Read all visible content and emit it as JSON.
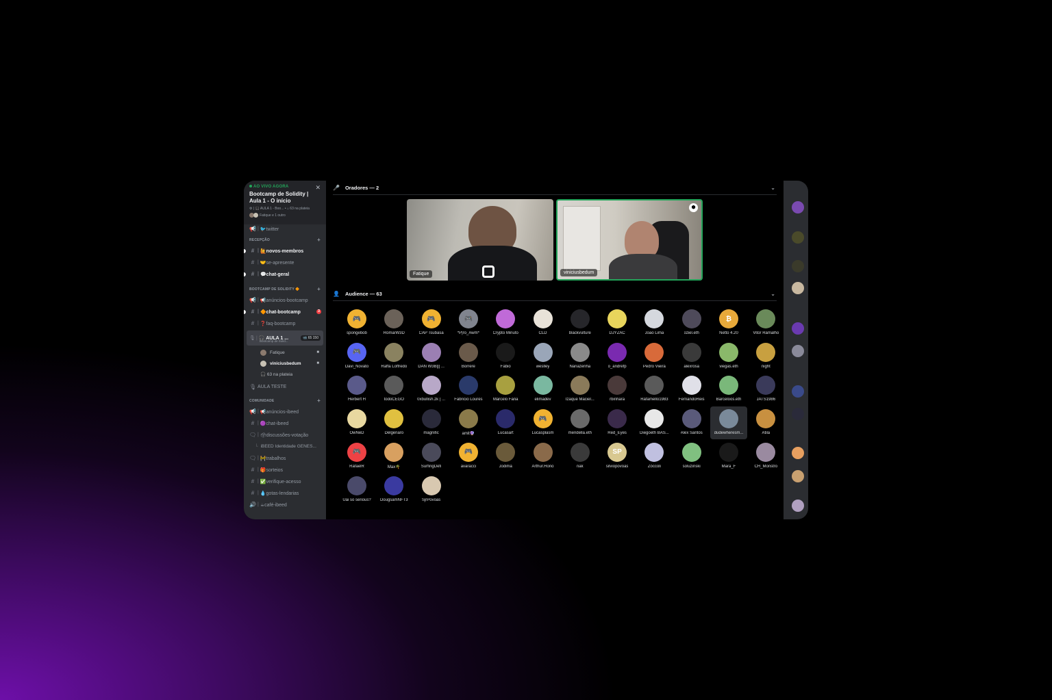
{
  "live": {
    "tag": "AO VIVO AGORA",
    "title": "Bootcamp de Solidity | Aula 1 - O início",
    "sub": "⚙ | 🎧 AULA 1 - Boo...  • ⌂ 63 na plateia",
    "users": "Fatique e 1 outro"
  },
  "sidebar": {
    "top_channel": "🐦twitter",
    "cat_recepcao": "RECEPÇÃO",
    "recepcao": [
      {
        "label": "🙋novos-membros",
        "unread": true
      },
      {
        "label": "🤝se-apresente",
        "unread": false
      },
      {
        "label": "💬chat-geral",
        "unread": true
      }
    ],
    "cat_bootcamp": "BOOTCAMP DE SOLIDITY 🔶",
    "bootcamp": [
      {
        "label": "📢anúncios-bootcamp",
        "unread": false
      },
      {
        "label": "🔶chat-bootcamp",
        "unread": true,
        "badge": "3"
      },
      {
        "label": "❓faq-bootcamp",
        "unread": false
      }
    ],
    "stage": {
      "name": "🎧 AULA 1 ...",
      "sub": "Bootcamp de Solid...",
      "count": "📹 65  150"
    },
    "voice_users": [
      {
        "name": "Fatique",
        "bold": false,
        "color": "#8b7a6e"
      },
      {
        "name": "viniciusbedum",
        "bold": true,
        "color": "#c7c1b4"
      }
    ],
    "audience_note": "🎧 63 na plateia",
    "aula_teste": "AULA TESTE",
    "cat_comunidade": "COMUNIDADE",
    "comunidade": [
      {
        "label": "📢anúncios-ibeed",
        "hash": "📢"
      },
      {
        "label": "🟣chat-ibeed",
        "hash": "#"
      },
      {
        "label": "🗳discussões-votação",
        "hash": "🗨"
      }
    ],
    "thread": "iBEED Identidade GENES...",
    "comunidade2": [
      {
        "label": "🚧trabalhos",
        "hash": "🗨"
      },
      {
        "label": "🎁sorteios",
        "hash": "#"
      },
      {
        "label": "✅verifique-acesso",
        "hash": "#"
      },
      {
        "label": "💧gotas-lendarias",
        "hash": "#"
      },
      {
        "label": "☕café-ibeed",
        "hash": "🔊"
      }
    ]
  },
  "speakers": {
    "header": "Oradores — 2",
    "tiles": [
      {
        "name": "Fatique"
      },
      {
        "name": "viniciusbedum"
      }
    ]
  },
  "audience": {
    "header": "Audience — 63",
    "members": [
      {
        "name": "spongebob",
        "color": "#f0b232",
        "glyph": "🎮"
      },
      {
        "name": "Roma/W3D",
        "color": "#6b6259",
        "glyph": ""
      },
      {
        "name": "CAP Tsubasa",
        "color": "#f0b232",
        "glyph": "🎮"
      },
      {
        "name": "*P|ro_Awm*",
        "color": "#80848e",
        "glyph": "🎮"
      },
      {
        "name": "Crypto Minuto",
        "color": "#c06ad8",
        "glyph": ""
      },
      {
        "name": "CLD",
        "color": "#e8e2d8",
        "glyph": ""
      },
      {
        "name": "blackvulture",
        "color": "#26262a",
        "glyph": ""
      },
      {
        "name": "DJYZAC",
        "color": "#e8d55c",
        "glyph": ""
      },
      {
        "name": "João Lima",
        "color": "#d5d8de",
        "glyph": ""
      },
      {
        "name": "oziel.eth",
        "color": "#4e4a5a",
        "glyph": ""
      },
      {
        "name": "Netto 4.20",
        "color": "#e8a93a",
        "glyph": "₿"
      },
      {
        "name": "Vitor Ramalho",
        "color": "#6a8a5a",
        "glyph": ""
      },
      {
        "name": "Davi_Novato",
        "color": "#5865f2",
        "glyph": "🎮"
      },
      {
        "name": "Raffa Loffredo",
        "color": "#8a8260",
        "glyph": ""
      },
      {
        "name": "DAN W3B||| ...",
        "color": "#9b7fb3",
        "glyph": ""
      },
      {
        "name": "Borrere",
        "color": "#6a5a4a",
        "glyph": ""
      },
      {
        "name": "Fábio",
        "color": "#1a1a1a",
        "glyph": ""
      },
      {
        "name": "weslley",
        "color": "#9aa6b8",
        "glyph": ""
      },
      {
        "name": "Nanazenha",
        "color": "#8a8a8a",
        "glyph": ""
      },
      {
        "name": "o_andrefp",
        "color": "#7a2ab0",
        "glyph": ""
      },
      {
        "name": "Pedro Vieira",
        "color": "#d86a3a",
        "glyph": ""
      },
      {
        "name": "alexrosa",
        "color": "#3a3a3a",
        "glyph": ""
      },
      {
        "name": "viegas.eth",
        "color": "#8ab86a",
        "glyph": ""
      },
      {
        "name": "night",
        "color": "#c8a040",
        "glyph": ""
      },
      {
        "name": "Herbert H",
        "color": "#5a5a8a",
        "glyph": ""
      },
      {
        "name": "todoCEGO",
        "color": "#5a5a5a",
        "glyph": ""
      },
      {
        "name": "0xbullish.zk | ...",
        "color": "#b8a8c8",
        "glyph": ""
      },
      {
        "name": "Fabricio Loures",
        "color": "#2a3a6a",
        "glyph": ""
      },
      {
        "name": "Marcelo Faria",
        "color": "#a8a040",
        "glyph": ""
      },
      {
        "name": "elimadev",
        "color": "#7ab8a0",
        "glyph": ""
      },
      {
        "name": "Izaque Maciel...",
        "color": "#8a7a5a",
        "glyph": ""
      },
      {
        "name": "rbinhara",
        "color": "#4a3a3a",
        "glyph": ""
      },
      {
        "name": "Rafamello1983",
        "color": "#5a5a5a",
        "glyph": ""
      },
      {
        "name": "FernandoReis",
        "color": "#e0e0e8",
        "glyph": ""
      },
      {
        "name": "Barceloos.eth",
        "color": "#7ab87a",
        "glyph": ""
      },
      {
        "name": "JATS1986",
        "color": "#3a3a5a",
        "glyph": ""
      },
      {
        "name": "OwNeD",
        "color": "#e8d8a0",
        "glyph": ""
      },
      {
        "name": "Delgenaro",
        "color": "#e0c040",
        "glyph": ""
      },
      {
        "name": "magnific",
        "color": "#2a2a3a",
        "glyph": ""
      },
      {
        "name": "amit🔮",
        "color": "#8a7a4a",
        "glyph": ""
      },
      {
        "name": "Lucasart",
        "color": "#2a2a6a",
        "glyph": ""
      },
      {
        "name": "Lucasplasm",
        "color": "#f0b232",
        "glyph": "🎮"
      },
      {
        "name": "mendella.eth",
        "color": "#6a6a6a",
        "glyph": ""
      },
      {
        "name": "Red_Eyes",
        "color": "#3a2a4a",
        "glyph": ""
      },
      {
        "name": "Diegoeth BAS...",
        "color": "#e8e8e8",
        "glyph": ""
      },
      {
        "name": "Alex Santos",
        "color": "#5a5a7a",
        "glyph": ""
      },
      {
        "name": "dudewheresm...",
        "color": "#7a8a9a",
        "glyph": ""
      },
      {
        "name": "Atila",
        "color": "#c89040",
        "glyph": ""
      },
      {
        "name": "RafaelR",
        "color": "#ed4245",
        "glyph": "🎮"
      },
      {
        "name": "Max🌴",
        "color": "#d8a060",
        "glyph": ""
      },
      {
        "name": "SurfingDefi",
        "color": "#4a4a5a",
        "glyph": ""
      },
      {
        "name": "avaracci",
        "color": "#f0b232",
        "glyph": "🎮"
      },
      {
        "name": "Jodimá",
        "color": "#6a5a3a",
        "glyph": ""
      },
      {
        "name": "Arthur.Hono",
        "color": "#8a6a4a",
        "glyph": ""
      },
      {
        "name": "nak",
        "color": "#3a3a3a",
        "glyph": ""
      },
      {
        "name": "silviopovoas",
        "color": "#d8c890",
        "glyph": "SP"
      },
      {
        "name": "Zöccoli",
        "color": "#c0c0e0",
        "glyph": ""
      },
      {
        "name": "soluzinski",
        "color": "#80c080",
        "glyph": ""
      },
      {
        "name": "Mara_F",
        "color": "#1a1a1a",
        "glyph": ""
      },
      {
        "name": "CH_Monstro",
        "color": "#9a8aa0",
        "glyph": ""
      },
      {
        "name": "Uai so serious?",
        "color": "#4a4a6a",
        "glyph": ""
      },
      {
        "name": "DougsamNFT3",
        "color": "#3a3aa0",
        "glyph": ""
      },
      {
        "name": "SjrPovoas",
        "color": "#d8c8b0",
        "glyph": ""
      }
    ]
  },
  "rail": {
    "avatars": [
      "#7a4ab0",
      "#4a4a2a",
      "#3a3a2a",
      "#c8b8a0",
      "#6a3ab0",
      "#8a8a9a",
      "#3a4a8a",
      "#2a2a3a",
      "#e8a060",
      "#c8a070",
      "#b0a0c0"
    ]
  }
}
